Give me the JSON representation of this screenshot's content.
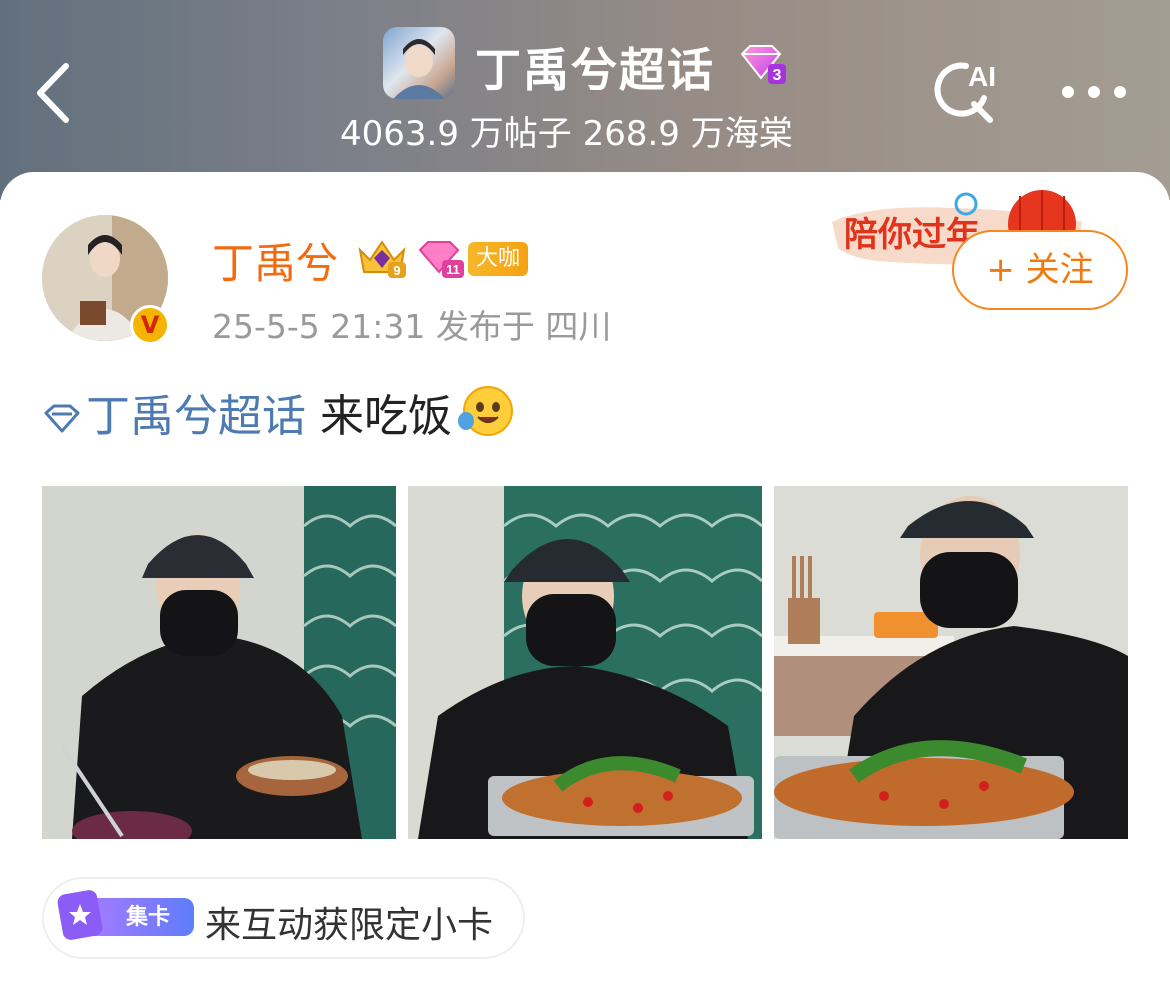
{
  "header": {
    "topic_title": "丁禹兮超话",
    "topic_level_badge": "3",
    "topic_stats": "4063.9 万帖子 268.9 万海棠",
    "ai_label": "AI",
    "icons": [
      "back-arrow-icon",
      "search-ai-icon",
      "more-icon"
    ]
  },
  "post": {
    "author_name": "丁禹兮",
    "verified_mark": "V",
    "crown_badge_level": "9",
    "diamond_badge_level": "11",
    "role_badge": "大咖",
    "meta": "25-5-5 21:31  发布于 四川",
    "promo_text": "陪你过年",
    "follow_label": "+ 关注",
    "topic_link": "丁禹兮超话",
    "text": " 来吃饭",
    "photos_count": 3
  },
  "footer": {
    "chip_tag": "集卡",
    "chip_text": "来互动获限定小卡"
  },
  "colors": {
    "accent_orange": "#f26b0f",
    "topic_blue": "#4d7bb1",
    "chip_purple": "#7b5cf5"
  }
}
